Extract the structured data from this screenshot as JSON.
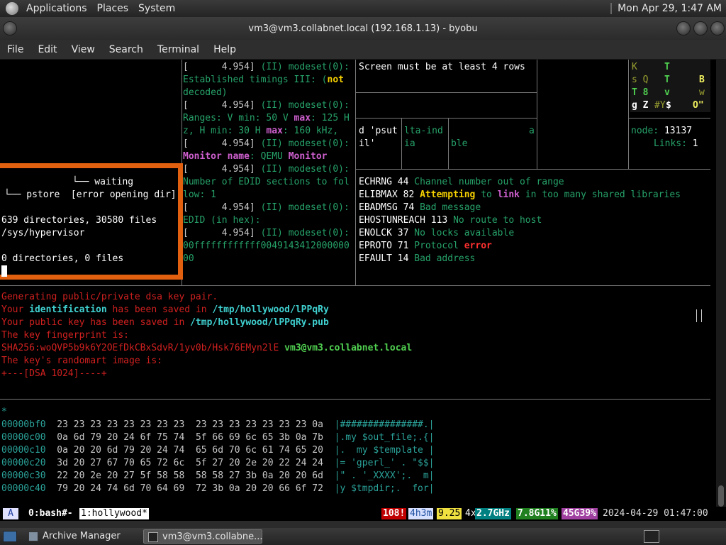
{
  "panel": {
    "menus": [
      "Applications",
      "Places",
      "System"
    ],
    "clock": "Mon Apr 29,  1:47 AM"
  },
  "window": {
    "title": "vm3@vm3.collabnet.local (192.168.1.13) - byobu"
  },
  "menubar": [
    "File",
    "Edit",
    "View",
    "Search",
    "Terminal",
    "Help"
  ],
  "pane_log": {
    "l1_ts": "[      4.954] ",
    "l1_msg": "(II) modeset(0):",
    "l2a": "Established timings III: (",
    "l2b": "not",
    "l3": "decoded)",
    "l4_ts": "[      4.954] ",
    "l4_msg": "(II) modeset(0):",
    "l5a": "Ranges: V min: 50 V ",
    "l5b": "max",
    "l5c": ": 125 H",
    "l6a": "z, H min: 30 H ",
    "l6b": "max",
    "l6c": ": 160 kHz,",
    "l7_ts": "[      4.954] ",
    "l7_msg": "(II) modeset(0):",
    "l8a": "Monitor name",
    "l8b": ": QEMU ",
    "l8c": "Monitor",
    "l9_ts": "[      4.954] ",
    "l9_msg": "(II) modeset(0):",
    "l10": "Number of EDID sections to fol",
    "l11": "low: 1",
    "l12_ts": "[      4.954] ",
    "l12_msg": "(II) modeset(0):",
    "l13": "EDID (in hex):",
    "l14_ts": "[      4.954] ",
    "l14_msg": "(II) modeset(0):",
    "l15": "00ffffffffffff0049143412000000",
    "l16": "00"
  },
  "pane_screen": {
    "msg": "Screen must be at least 4 rows",
    "c1a": "d 'psut",
    "c1b": "il'",
    "c2a": "lta-ind",
    "c2b": "ia",
    "c3a": "a",
    "c3b": "ble"
  },
  "pane_matrix": {
    "r1": [
      "K",
      "T"
    ],
    "r2": [
      "s Q",
      "T",
      "B"
    ],
    "r3": [
      "T 8",
      "v",
      "w"
    ],
    "r4": [
      "g Z",
      "#Y",
      "$",
      "O\""
    ],
    "node_label": "node: ",
    "node_val": "13137",
    "links_label": "Links: ",
    "links_val": "1"
  },
  "pane_errno": [
    {
      "name": "ECHRNG",
      "num": "44",
      "text": "Channel number out of range"
    },
    {
      "name": "ELIBMAX",
      "num": "82",
      "hl1": "Attempting",
      "mid": " to ",
      "hl2": "link",
      "text": " in too many shared libraries"
    },
    {
      "name": "EBADMSG",
      "num": "74",
      "text": "Bad message"
    },
    {
      "name": "EHOSTUNREACH",
      "num": "113",
      "text": "No route to host"
    },
    {
      "name": "ENOLCK",
      "num": "37",
      "text": "No locks available"
    },
    {
      "name": "EPROTO",
      "num": "71",
      "text": "Protocol ",
      "hl": "error"
    },
    {
      "name": "EFAULT",
      "num": "14",
      "text": "Bad address"
    }
  ],
  "pane_tree": {
    "waiting": "└── waiting",
    "pstore": "└── pstore  [error opening dir]",
    "summary1": "639 directories, 30580 files",
    "path": "/sys/hypervisor",
    "summary2": "0 directories, 0 files"
  },
  "pane_keygen": {
    "l1": "Generating public/private dsa key pair.",
    "l2a": "Your ",
    "l2b": "identification",
    "l2c": " has been saved in ",
    "l2d": "/tmp/hollywood/lPPqRy",
    "l3a": "Your public key has been saved in ",
    "l3b": "/tmp/hollywood/lPPqRy.pub",
    "l4": "The key fingerprint is:",
    "l5a": "SHA256:woQVP5b9k6Y2OEfDkCBxSdvR/1yv0b/Hsk76EMyn2lE ",
    "l5b": "vm3@vm3.collabnet.local",
    "l6": "The key's randomart image is:",
    "l7": "+---[DSA 1024]----+"
  },
  "pane_hex": {
    "star": "*",
    "rows": [
      {
        "addr": "00000bf0",
        "bytes": "23 23 23 23 23 23 23 23  23 23 23 23 23 23 23 0a",
        "ascii": "|###############.|"
      },
      {
        "addr": "00000c00",
        "bytes": "0a 6d 79 20 24 6f 75 74  5f 66 69 6c 65 3b 0a 7b",
        "ascii": "|.my $out_file;.{|"
      },
      {
        "addr": "00000c10",
        "bytes": "0a 20 20 6d 79 20 24 74  65 6d 70 6c 61 74 65 20",
        "ascii": "|.  my $template |"
      },
      {
        "addr": "00000c20",
        "bytes": "3d 20 27 67 70 65 72 6c  5f 27 20 2e 20 22 24 24",
        "ascii": "|= 'gperl_' . \"$$|"
      },
      {
        "addr": "00000c30",
        "bytes": "22 20 2e 20 27 5f 58 58  58 58 27 3b 0a 20 20 6d",
        "ascii": "|\" . '_XXXX';.  m|"
      },
      {
        "addr": "00000c40",
        "bytes": "79 20 24 74 6d 70 64 69  72 3b 0a 20 20 66 6f 72",
        "ascii": "|y $tmpdir;.  for|"
      }
    ]
  },
  "statusbar": {
    "logo": "A",
    "win0": "0:bash#-",
    "win1": "1:hollywood*",
    "updates": "108!",
    "uptime": "4h3m",
    "load": "9.25",
    "cpu_count": "4x",
    "cpu_freq": "2.7GHz",
    "mem": "7.8G11%",
    "disk": "45G39%",
    "datetime": "2024-04-29 01:47:00"
  },
  "taskbar": {
    "tasks": [
      "Archive Manager",
      "vm3@vm3.collabne..."
    ]
  }
}
